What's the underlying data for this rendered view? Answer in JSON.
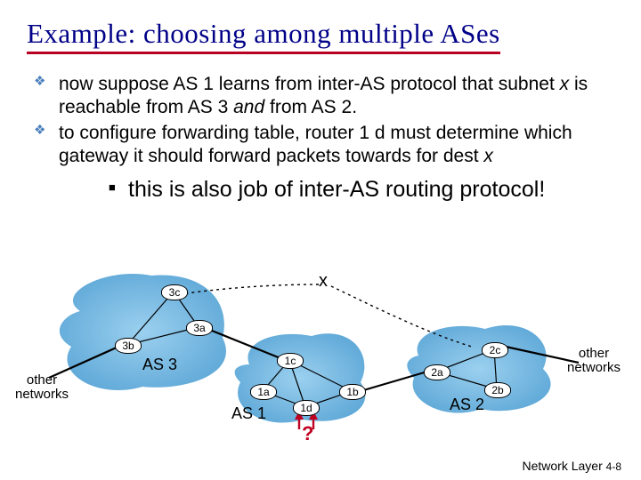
{
  "title": "Example: choosing among multiple ASes",
  "bullets": {
    "b1_pre": "now suppose AS 1 learns from inter-AS protocol that subnet ",
    "b1_x": "x",
    "b1_mid": " is reachable from AS 3 ",
    "b1_and": "and",
    "b1_post": " from AS 2.",
    "b2": "to configure forwarding table, router 1 d must determine which gateway it should forward packets towards for dest ",
    "b2_x": "x",
    "sub1": "this is also job of inter-AS routing protocol!"
  },
  "diagram": {
    "x_label": "x",
    "routers": {
      "r3c": "3c",
      "r3a": "3a",
      "r3b": "3b",
      "r1c": "1c",
      "r1a": "1a",
      "r1d": "1d",
      "r1b": "1b",
      "r2a": "2a",
      "r2c": "2c",
      "r2b": "2b"
    },
    "as_labels": {
      "as1": "AS 1",
      "as2": "AS 2",
      "as3": "AS 3"
    },
    "side_labels": {
      "left": "other\nnetworks",
      "right": "other\nnetworks"
    },
    "qmark": "?"
  },
  "footer": {
    "text": "Network Layer",
    "page": "4-8"
  },
  "chart_data": {
    "type": "diagram",
    "title": "Example: choosing among multiple ASes",
    "nodes": [
      {
        "id": "3c",
        "as": "AS3"
      },
      {
        "id": "3a",
        "as": "AS3"
      },
      {
        "id": "3b",
        "as": "AS3"
      },
      {
        "id": "1c",
        "as": "AS1"
      },
      {
        "id": "1a",
        "as": "AS1"
      },
      {
        "id": "1d",
        "as": "AS1"
      },
      {
        "id": "1b",
        "as": "AS1"
      },
      {
        "id": "2a",
        "as": "AS2"
      },
      {
        "id": "2c",
        "as": "AS2"
      },
      {
        "id": "2b",
        "as": "AS2"
      },
      {
        "id": "x",
        "as": "external"
      }
    ],
    "as_groups": [
      "AS1",
      "AS2",
      "AS3"
    ],
    "intra_as_links": [
      [
        "3c",
        "3a"
      ],
      [
        "3c",
        "3b"
      ],
      [
        "3a",
        "3b"
      ],
      [
        "1c",
        "1a"
      ],
      [
        "1c",
        "1d"
      ],
      [
        "1c",
        "1b"
      ],
      [
        "1a",
        "1d"
      ],
      [
        "1d",
        "1b"
      ],
      [
        "2a",
        "2c"
      ],
      [
        "2a",
        "2b"
      ],
      [
        "2c",
        "2b"
      ]
    ],
    "inter_as_links": [
      [
        "3a",
        "1c"
      ],
      [
        "1b",
        "2a"
      ]
    ],
    "external_links": [
      {
        "from": "3b",
        "to": "other networks (left)"
      },
      {
        "from": "2c",
        "to": "other networks (right)"
      },
      {
        "from": "x",
        "to": "AS3",
        "style": "dotted"
      },
      {
        "from": "x",
        "to": "AS2",
        "style": "dotted"
      }
    ],
    "highlight_router": "1d",
    "question_arrow_from": "1d",
    "annotations": [
      "?"
    ]
  }
}
